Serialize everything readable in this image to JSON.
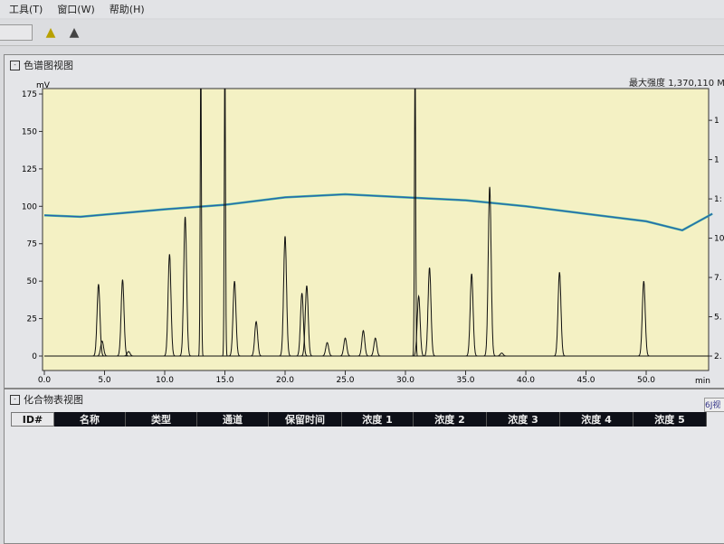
{
  "menu": [
    "工具(T)",
    "窗口(W)",
    "帮助(H)"
  ],
  "toolbar": {
    "icons": [
      "peak-integration-icon",
      "chromatogram-icon"
    ]
  },
  "chromatogram_view": {
    "title": "色谱图视图",
    "max_intensity_label": "最大强度",
    "max_intensity_value": "1,370,110",
    "right_unit": "M"
  },
  "compound_view": {
    "title": "化合物表视图",
    "side_button": "6J视",
    "columns": [
      "ID#",
      "名称",
      "类型",
      "通道",
      "保留时间",
      "浓度 1",
      "浓度 2",
      "浓度 3",
      "浓度 4",
      "浓度 5"
    ]
  },
  "chart_data": {
    "type": "line",
    "xlabel": "min",
    "ylabel": "mV",
    "xlim": [
      0,
      55.5
    ],
    "ylim": [
      -8,
      178
    ],
    "x_ticks": [
      "0.0",
      "5.0",
      "10.0",
      "15.0",
      "20.0",
      "25.0",
      "30.0",
      "35.0",
      "40.0",
      "45.0",
      "50.0"
    ],
    "y_ticks": [
      "0",
      "25",
      "50",
      "75",
      "100",
      "125",
      "150",
      "175"
    ],
    "right_ticks": [
      "2.",
      "5.",
      "7.",
      "10",
      "1:",
      "1",
      "1"
    ],
    "background": "#f4f1c4",
    "peaks": [
      {
        "t": 4.5,
        "h": 48
      },
      {
        "t": 4.8,
        "h": 10
      },
      {
        "t": 6.5,
        "h": 51
      },
      {
        "t": 7.0,
        "h": 3
      },
      {
        "t": 10.4,
        "h": 68
      },
      {
        "t": 11.7,
        "h": 93
      },
      {
        "t": 13.0,
        "h": 200
      },
      {
        "t": 15.0,
        "h": 200
      },
      {
        "t": 15.8,
        "h": 50
      },
      {
        "t": 17.6,
        "h": 23
      },
      {
        "t": 20.0,
        "h": 80
      },
      {
        "t": 21.4,
        "h": 42
      },
      {
        "t": 21.8,
        "h": 47
      },
      {
        "t": 23.5,
        "h": 9
      },
      {
        "t": 25.0,
        "h": 12
      },
      {
        "t": 26.5,
        "h": 17
      },
      {
        "t": 27.5,
        "h": 12
      },
      {
        "t": 30.8,
        "h": 200
      },
      {
        "t": 31.1,
        "h": 40
      },
      {
        "t": 32.0,
        "h": 59
      },
      {
        "t": 35.5,
        "h": 55
      },
      {
        "t": 37.0,
        "h": 113
      },
      {
        "t": 38.0,
        "h": 2
      },
      {
        "t": 42.8,
        "h": 56
      },
      {
        "t": 49.8,
        "h": 50
      }
    ],
    "secondary_trace": {
      "color": "#2a5fb0",
      "x": [
        0,
        3,
        10,
        15,
        20,
        25,
        30,
        35,
        40,
        45,
        50,
        53,
        55.5
      ],
      "y": [
        94,
        93,
        98,
        101,
        106,
        108,
        106,
        104,
        100,
        95,
        90,
        84,
        95
      ]
    }
  }
}
